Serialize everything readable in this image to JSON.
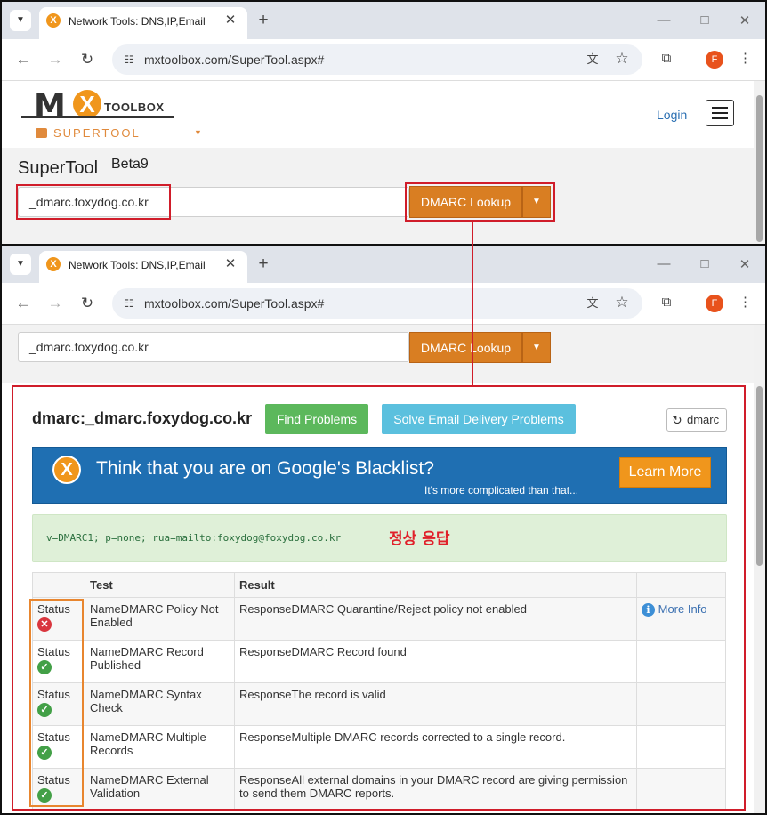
{
  "browser": {
    "tab_title": "Network Tools: DNS,IP,Email",
    "url": "mxtoolbox.com/SuperTool.aspx#",
    "profile_initial": "F"
  },
  "header": {
    "logo_text": "TOOLBOX",
    "logo_sub": "SUPERTOOL",
    "login": "Login"
  },
  "page": {
    "title": "SuperTool",
    "title_beta": "Beta9",
    "search_value": "_dmarc.foxydog.co.kr",
    "lookup_button": "DMARC Lookup"
  },
  "results": {
    "heading": "dmarc:_dmarc.foxydog.co.kr",
    "find_problems": "Find Problems",
    "solve_email": "Solve Email Delivery Problems",
    "refresh_label": "dmarc",
    "banner_title": "Think that you are on Google's Blacklist?",
    "banner_sub": "It's more complicated than that...",
    "learn_more": "Learn More",
    "record_text": "v=DMARC1; p=none; rua=mailto:foxydog@foxydog.co.kr",
    "annotation": "정상 응답",
    "table": {
      "headers": [
        "",
        "Test",
        "Result",
        ""
      ],
      "rows": [
        {
          "status": "Status",
          "state": "error",
          "name": "NameDMARC Policy Not Enabled",
          "result": "ResponseDMARC Quarantine/Reject policy not enabled",
          "more": "More Info"
        },
        {
          "status": "Status",
          "state": "ok",
          "name": "NameDMARC Record Published",
          "result": "ResponseDMARC Record found",
          "more": ""
        },
        {
          "status": "Status",
          "state": "ok",
          "name": "NameDMARC Syntax Check",
          "result": "ResponseThe record is valid",
          "more": ""
        },
        {
          "status": "Status",
          "state": "ok",
          "name": "NameDMARC Multiple Records",
          "result": "ResponseMultiple DMARC records corrected to a single record.",
          "more": ""
        },
        {
          "status": "Status",
          "state": "ok",
          "name": "NameDMARC External Validation",
          "result": "ResponseAll external domains in your DMARC record are giving permission to send them DMARC reports.",
          "more": ""
        }
      ]
    }
  },
  "colors": {
    "accent_orange": "#d97e22",
    "highlight_red": "#d01d2a",
    "status_ok": "#43a047",
    "status_error": "#d9363e"
  }
}
